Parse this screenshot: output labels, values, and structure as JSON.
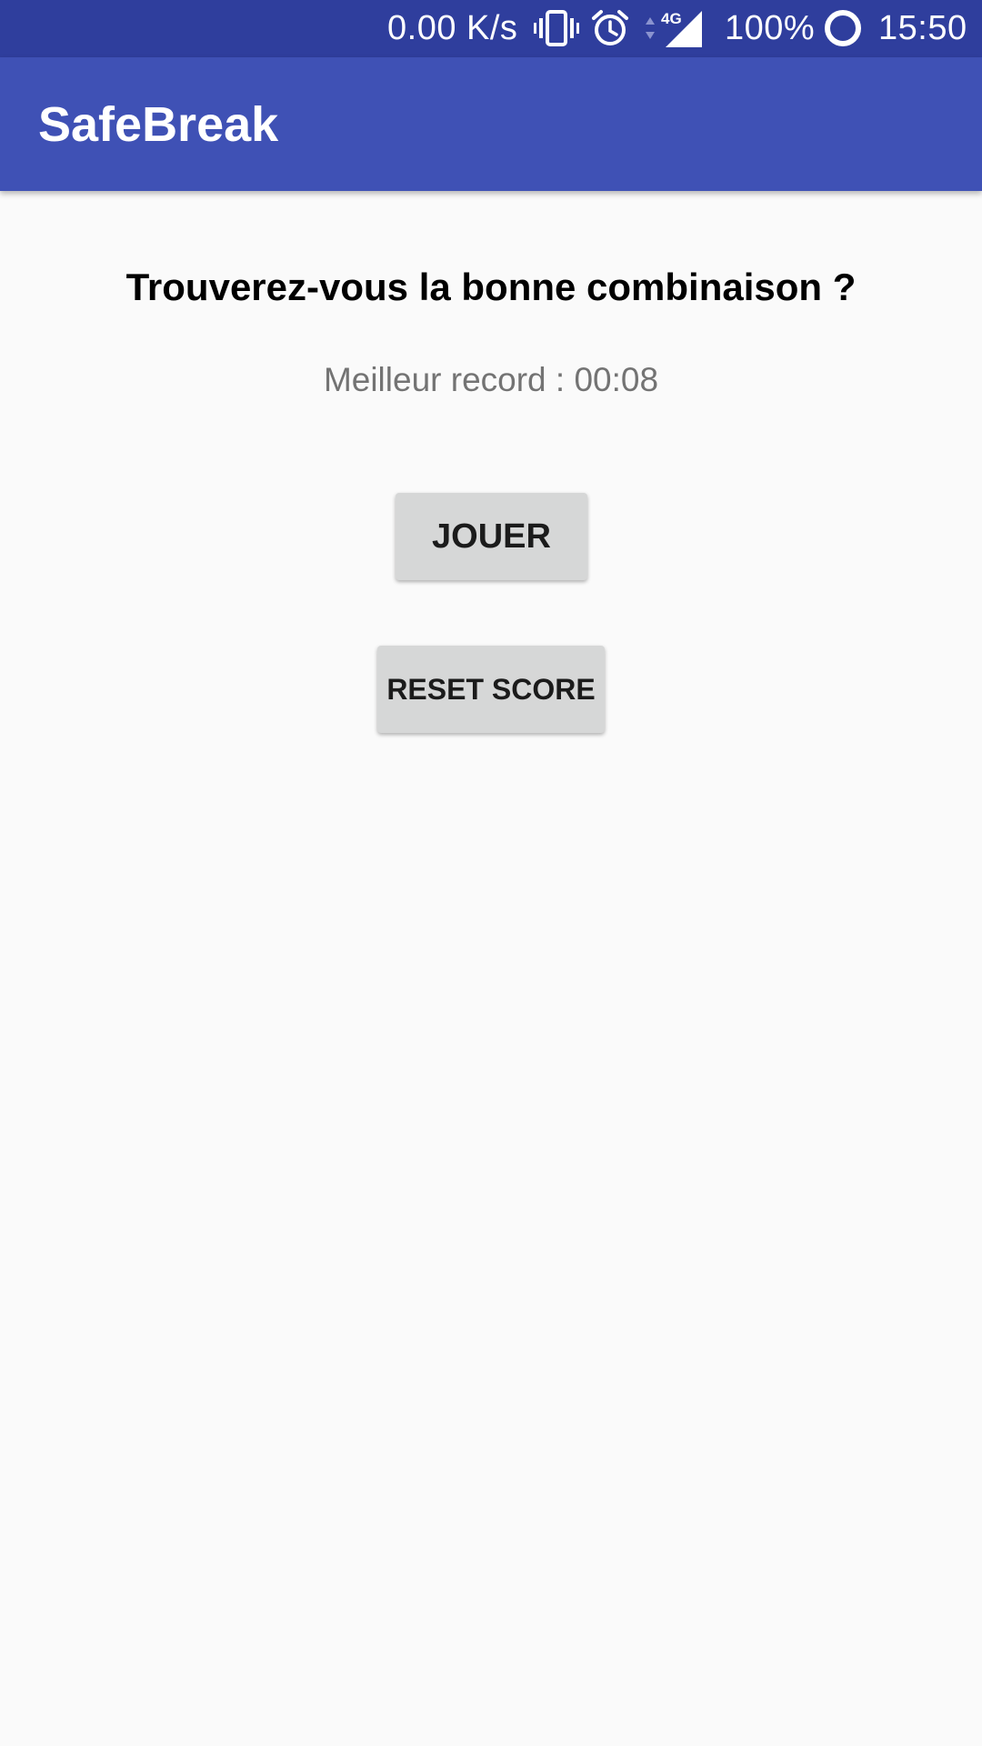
{
  "status_bar": {
    "speed": "0.00 K/s",
    "network": "4G",
    "battery": "100%",
    "time": "15:50",
    "icons": [
      "vibrate-icon",
      "alarm-icon",
      "data-arrows-icon",
      "signal-icon",
      "battery-ring-icon"
    ]
  },
  "app_bar": {
    "title": "SafeBreak"
  },
  "main": {
    "headline": "Trouverez-vous la bonne combinaison ?",
    "record": "Meilleur record : 00:08",
    "play_label": "JOUER",
    "reset_label": "RESET SCORE"
  },
  "colors": {
    "status_bar": "#2f3e9d",
    "app_bar": "#3f51b5",
    "background": "#fafafa",
    "button": "#d6d7d7"
  }
}
